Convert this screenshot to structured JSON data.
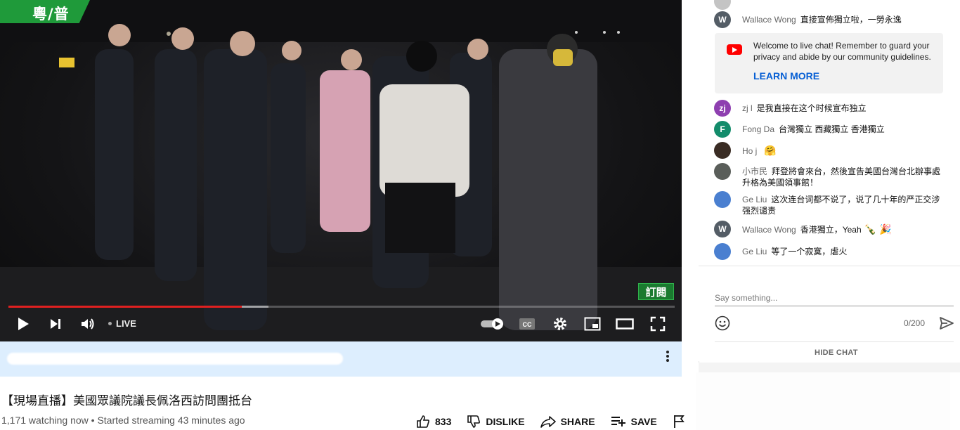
{
  "player": {
    "lang_badge": "粵/普",
    "subscribe_badge": "訂閱",
    "live_label": "LIVE",
    "progress_played": 0.35,
    "progress_buffered": 0.39
  },
  "video": {
    "title": "【現場直播】美國眾議院議長佩洛西訪問團抵台",
    "watching": "1,171 watching now",
    "started": "Started streaming 43 minutes ago",
    "likes": "833",
    "dislike_label": "DISLIKE",
    "share_label": "SHARE",
    "save_label": "SAVE"
  },
  "chat": {
    "messages": [
      {
        "author": "Wallace Wong",
        "text": "直接宣佈獨立啦，一勞永逸",
        "avatar_letter": "W",
        "avatar_color": "#545d66"
      },
      {
        "author": "zj l",
        "text": "是我直接在这个时候宣布独立",
        "avatar_letter": "zj",
        "avatar_color": "#8e3fb0"
      },
      {
        "author": "Fong Da",
        "text": "台灣獨立 西藏獨立 香港獨立",
        "avatar_letter": "F",
        "avatar_color": "#138c6b"
      },
      {
        "author": "Ho j",
        "text": "",
        "emoji": "🤗",
        "avatar_color": "#3a2c24"
      },
      {
        "author": "小市民",
        "text": "拜登將會來台，然後宣告美國台灣台北辦事處升格為美國領事館！",
        "avatar_color": "#5a5e5a"
      },
      {
        "author": "Ge Liu",
        "text": "这次连台词都不说了，说了几十年的严正交涉强烈谴责",
        "avatar_color": "#4a7fd0"
      },
      {
        "author": "Wallace Wong",
        "text": "香港獨立，Yeah",
        "emoji": "🍾 🎉",
        "avatar_letter": "W",
        "avatar_color": "#545d66"
      },
      {
        "author": "Ge Liu",
        "text": "等了一个寂寞，虐火",
        "avatar_color": "#4a7fd0"
      }
    ],
    "welcome": {
      "text": "Welcome to live chat! Remember to guard your privacy and abide by our community guidelines.",
      "learn_more": "LEARN MORE"
    },
    "input_placeholder": "Say something...",
    "char_counter": "0/200",
    "hide_chat": "HIDE CHAT"
  },
  "icons": [
    "play-icon",
    "next-icon",
    "volume-icon",
    "autoplay-toggle-icon",
    "cc-icon",
    "gear-icon",
    "miniplayer-icon",
    "theater-icon",
    "fullscreen-icon",
    "kebab-icon",
    "thumbs-up-icon",
    "thumbs-down-icon",
    "share-icon",
    "save-icon",
    "flag-icon",
    "emoji-icon",
    "send-icon",
    "youtube-icon"
  ],
  "colors": {
    "progress": "#e02020",
    "lang_badge": "#1f9a3a",
    "learn_more": "#065fd4",
    "under_player_bar": "#ddeefe"
  }
}
